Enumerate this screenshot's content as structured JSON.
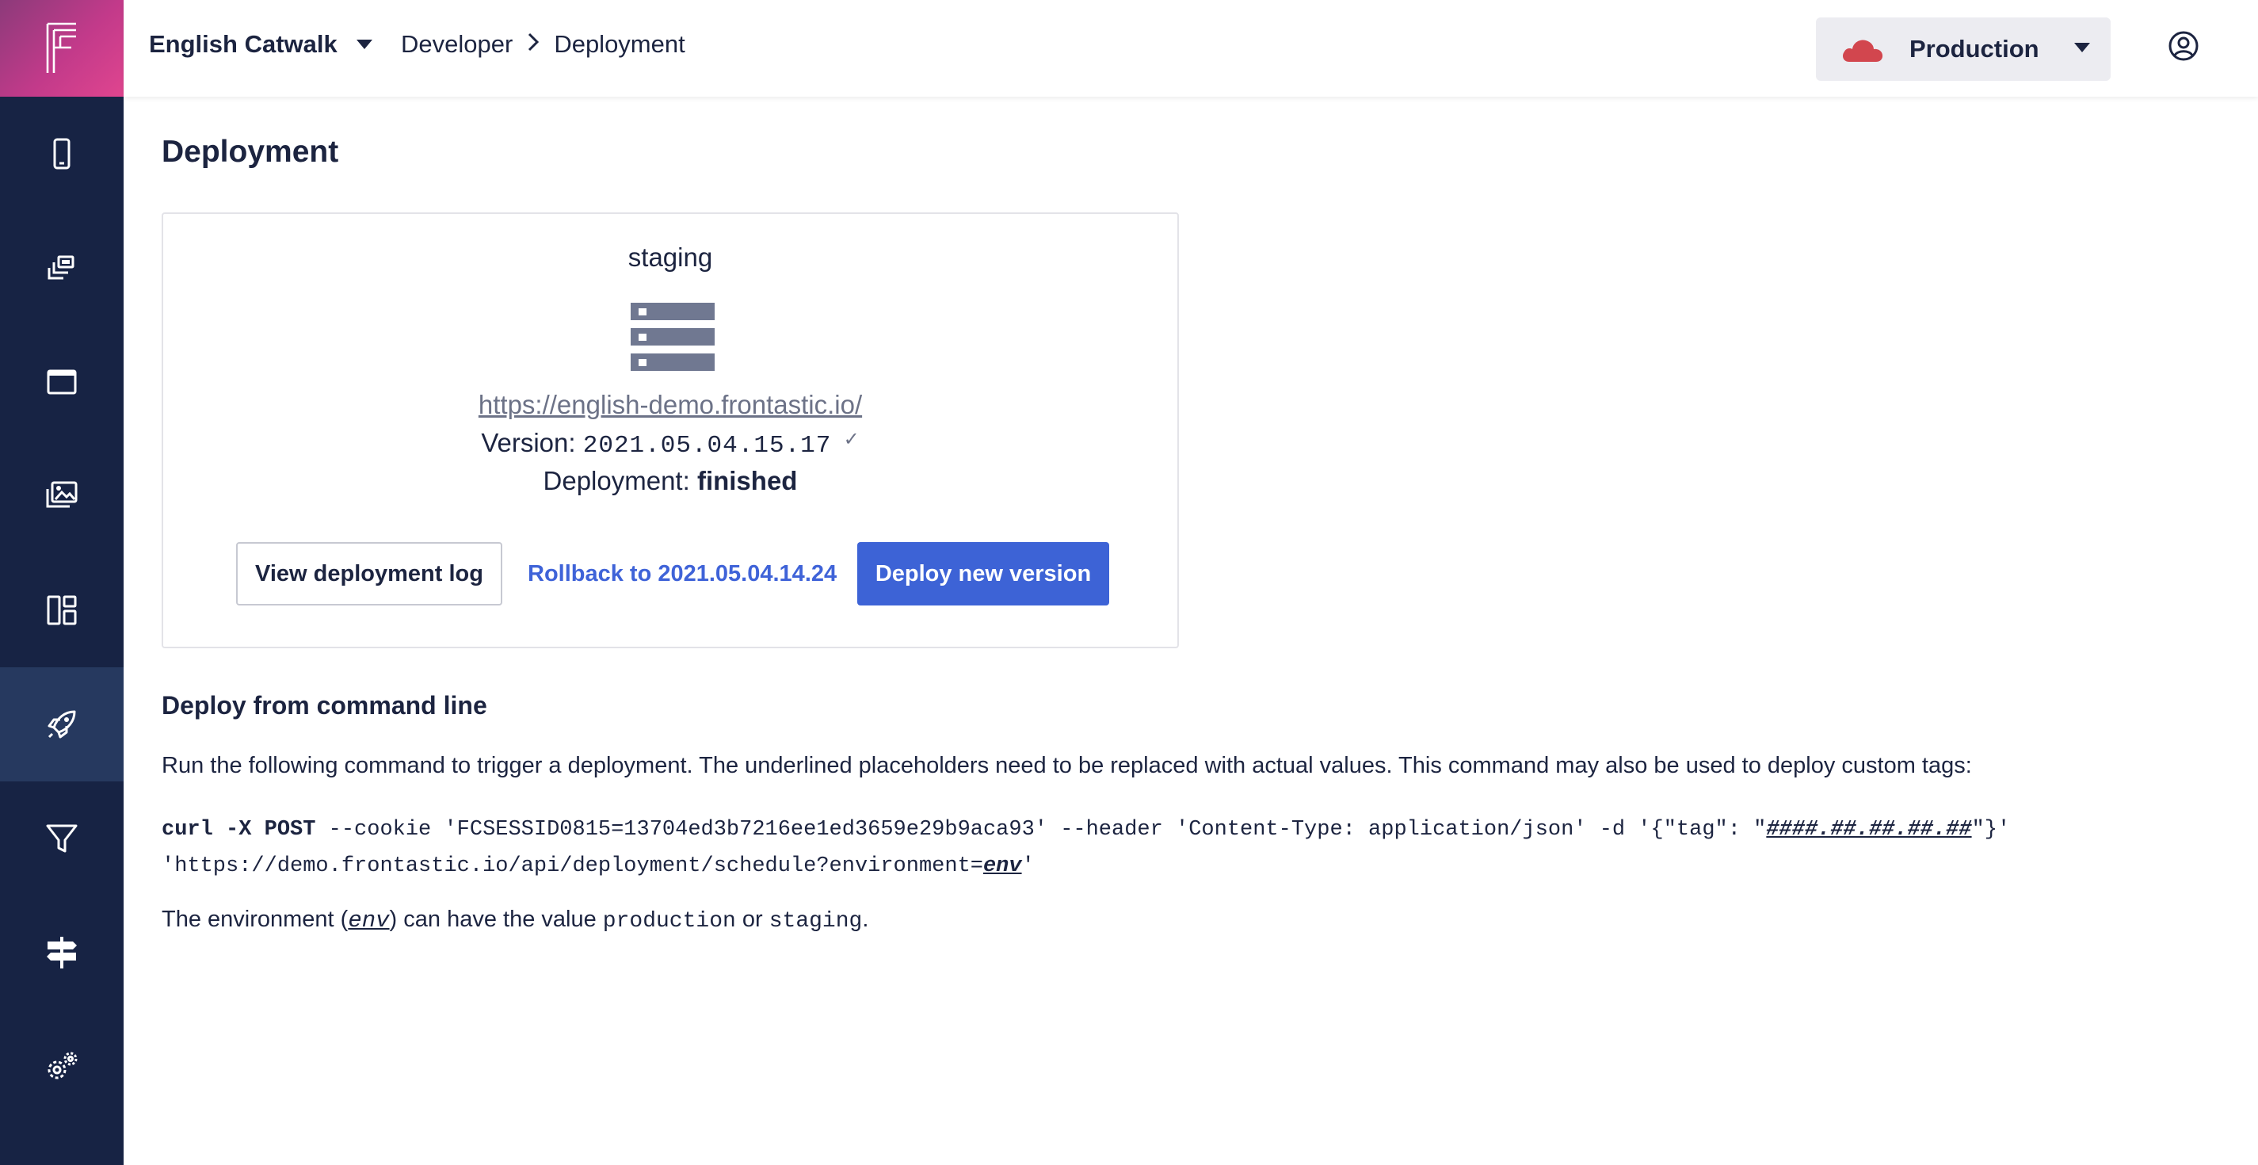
{
  "topbar": {
    "project": "English Catwalk",
    "breadcrumb": [
      "Developer",
      "Deployment"
    ],
    "environment": "Production"
  },
  "sidebar": {
    "items": [
      {
        "icon": "mobile-icon"
      },
      {
        "icon": "pages-icon"
      },
      {
        "icon": "window-icon"
      },
      {
        "icon": "media-icon"
      },
      {
        "icon": "dashboard-icon"
      },
      {
        "icon": "rocket-icon",
        "active": true
      },
      {
        "icon": "filter-icon"
      },
      {
        "icon": "signpost-icon"
      },
      {
        "icon": "settings-icon"
      }
    ]
  },
  "main": {
    "title": "Deployment",
    "card": {
      "environment": "staging",
      "url": "https://english-demo.frontastic.io/",
      "version_label": "Version:",
      "version": "2021.05.04.15.17",
      "deployment_label": "Deployment:",
      "deployment_status": "finished",
      "view_log": "View deployment log",
      "rollback": "Rollback to 2021.05.04.14.24",
      "deploy_new": "Deploy new version"
    },
    "cli": {
      "title": "Deploy from command line",
      "description": "Run the following command to trigger a deployment. The underlined placeholders need to be replaced with actual values. This command may also be used to deploy custom tags:",
      "cmd_curl": "curl",
      "cmd_x": "-X",
      "cmd_post": "POST",
      "cmd_part1": " --cookie 'FCSESSID0815=13704ed3b7216ee1ed3659e29b9aca93' --header 'Content-Type: application/json' -d '{\"tag\": \"",
      "cmd_tag_placeholder": "####.##.##.##.##",
      "cmd_part2": "\"}'",
      "cmd_url": "'https://demo.frontastic.io/api/deployment/schedule?environment=",
      "cmd_env_placeholder": "env",
      "cmd_url_end": "'",
      "note_prefix": "The environment (",
      "note_env": "env",
      "note_mid": ") can have the value ",
      "note_production": "production",
      "note_or": " or ",
      "note_staging": "staging",
      "note_end": "."
    }
  },
  "colors": {
    "sidebar_bg": "#172344",
    "sidebar_active": "#26395f",
    "primary": "#3d63d6",
    "cloud": "#d2464e"
  }
}
